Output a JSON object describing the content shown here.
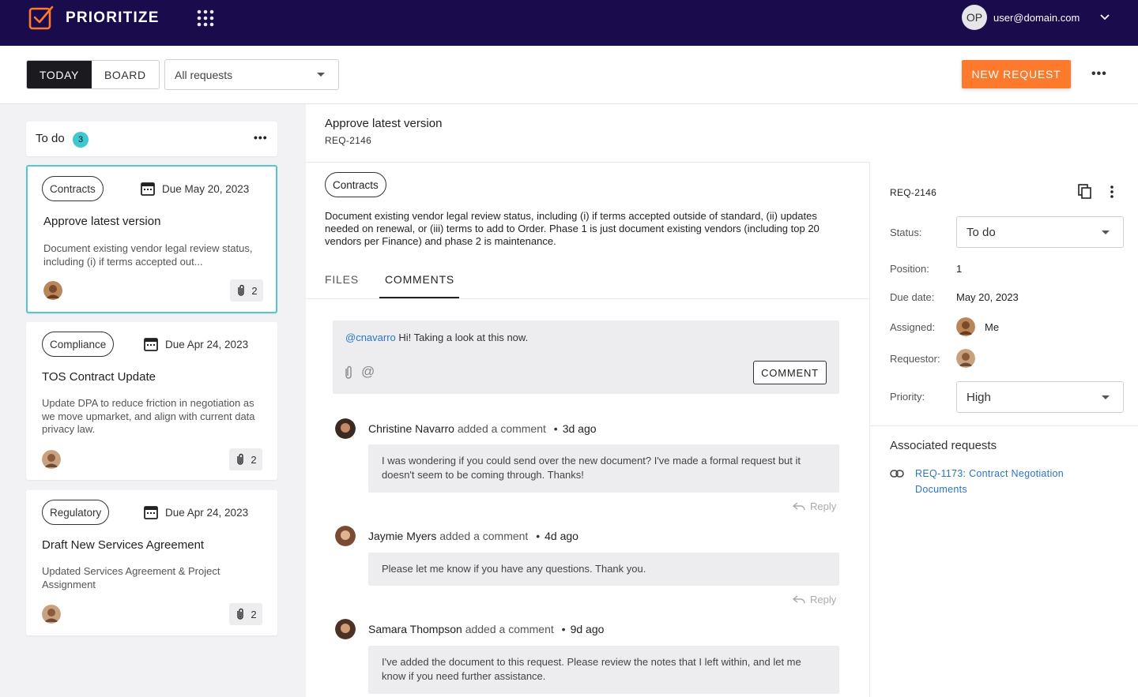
{
  "app": {
    "title": "PRIORITIZE"
  },
  "user": {
    "initials": "OP",
    "email": "user@domain.com"
  },
  "toolbar": {
    "views": [
      {
        "label": "TODAY",
        "active": true
      },
      {
        "label": "BOARD",
        "active": false
      }
    ],
    "filter": "All requests",
    "new_request": "NEW REQUEST"
  },
  "column": {
    "title": "To do",
    "count": "3",
    "cards": [
      {
        "tag": "Contracts",
        "due": "Due May 20, 2023",
        "title": "Approve latest version",
        "desc": "Document existing vendor legal review status, including (i) if terms accepted out...",
        "attachments": "2"
      },
      {
        "tag": "Compliance",
        "due": "Due Apr 24, 2023",
        "title": "TOS Contract Update",
        "desc": "Update DPA to reduce friction in negotiation as we move upmarket, and align with current data privacy law.",
        "attachments": "2"
      },
      {
        "tag": "Regulatory",
        "due": "Due Apr 24, 2023",
        "title": "Draft New Services Agreement",
        "desc": "Updated Services Agreement & Project Assignment",
        "attachments": "2"
      }
    ]
  },
  "detail": {
    "title": "Approve latest version",
    "id": "REQ-2146",
    "tag": "Contracts",
    "description": "Document existing vendor legal review status, including (i) if terms accepted outside of standard, (ii) updates needed on renewal, or (iii) terms to add to Order. Phase 1 is just document existing vendors (including top 20 vendors per Finance) and phase 2 is maintenance.",
    "tabs": [
      {
        "label": "FILES",
        "active": false
      },
      {
        "label": "COMMENTS",
        "active": true
      }
    ],
    "draft": {
      "mention": "@cnavarro",
      "text": " Hi! Taking a look at this now.",
      "button": "COMMENT"
    },
    "comments": [
      {
        "author": "Christine Navarro",
        "action": " added a comment",
        "sep": "•",
        "time": "3d ago",
        "body": "I was wondering if you could send over the new document? I've made a formal request but it doesn't seem to be coming through. Thanks!",
        "reply": "Reply"
      },
      {
        "author": "Jaymie Myers",
        "action": " added a comment",
        "sep": "•",
        "time": "4d ago",
        "body": "Please let me know if you have any questions. Thank you.",
        "reply": "Reply"
      },
      {
        "author": "Samara Thompson",
        "action": " added a comment",
        "sep": "•",
        "time": "9d ago",
        "body": "I've added the document to this request. Please review the notes that I left within, and let me know if you need further assistance."
      }
    ]
  },
  "sidebar": {
    "id": "REQ-2146",
    "status_label": "Status:",
    "status": "To do",
    "position_label": "Position:",
    "position": "1",
    "due_label": "Due date:",
    "due": "May 20, 2023",
    "assigned_label": "Assigned:",
    "assigned": "Me",
    "requestor_label": "Requestor:",
    "priority_label": "Priority:",
    "priority": "High",
    "assoc_title": "Associated requests",
    "assoc_link": "REQ-1173: Contract Negotiation Documents"
  },
  "colors": {
    "topbar": "#1a0b4d",
    "accent": "#fd7a2d",
    "teal": "#54c6cf",
    "link": "#2a74c9"
  }
}
